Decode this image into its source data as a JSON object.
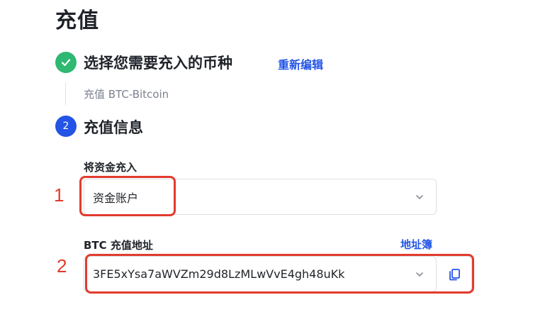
{
  "page": {
    "title": "充值"
  },
  "step1": {
    "title": "选择您需要充入的币种",
    "edit_link": "重新编辑",
    "summary": "充值 BTC-Bitcoin",
    "icon": "check-circle-icon",
    "color": "#2eb872"
  },
  "step2": {
    "number": "2",
    "title": "充值信息",
    "color": "#2354e6"
  },
  "deposit_to": {
    "label": "将资金充入",
    "selected": "资金账户"
  },
  "deposit_address": {
    "label": "BTC 充值地址",
    "address_book_link": "地址簿",
    "value": "3FE5xYsa7aWVZm29d8LzMLwVvE4gh48uKk",
    "copy_icon": "copy-icon"
  },
  "annotations": {
    "marker_1": "1",
    "marker_2": "2",
    "color": "#e23b2d"
  },
  "colors": {
    "accent": "#2354e6",
    "success": "#2eb872"
  }
}
